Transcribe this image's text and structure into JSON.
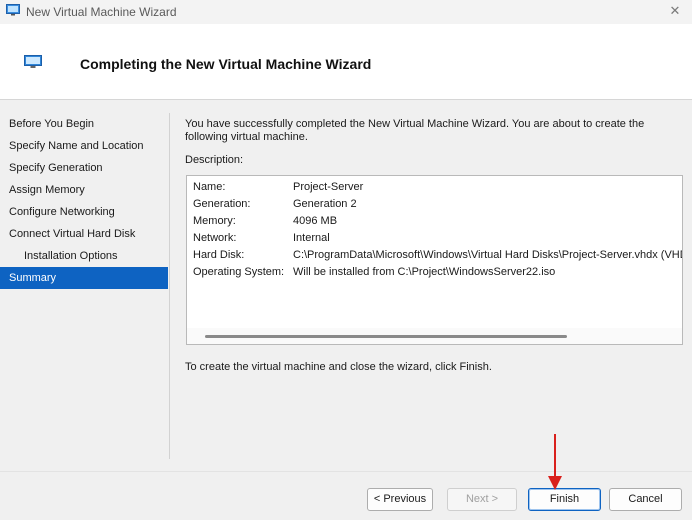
{
  "window": {
    "title": "New Virtual Machine Wizard",
    "close_glyph": "✕"
  },
  "header": {
    "title": "Completing the New Virtual Machine Wizard"
  },
  "nav": {
    "items": [
      {
        "label": "Before You Begin"
      },
      {
        "label": "Specify Name and Location"
      },
      {
        "label": "Specify Generation"
      },
      {
        "label": "Assign Memory"
      },
      {
        "label": "Configure Networking"
      },
      {
        "label": "Connect Virtual Hard Disk"
      },
      {
        "label": "Installation Options"
      },
      {
        "label": "Summary"
      }
    ],
    "active_index": 7
  },
  "main": {
    "intro": "You have successfully completed the New Virtual Machine Wizard. You are about to create the following virtual machine.",
    "description_label": "Description:",
    "rows": [
      {
        "key": "Name:",
        "value": "Project-Server"
      },
      {
        "key": "Generation:",
        "value": "Generation 2"
      },
      {
        "key": "Memory:",
        "value": "4096 MB"
      },
      {
        "key": "Network:",
        "value": "Internal"
      },
      {
        "key": "Hard Disk:",
        "value": "C:\\ProgramData\\Microsoft\\Windows\\Virtual Hard Disks\\Project-Server.vhdx (VHDX, dynamically expanding)"
      },
      {
        "key": "Operating System:",
        "value": "Will be installed from C:\\Project\\WindowsServer22.iso"
      }
    ],
    "finish_note": "To create the virtual machine and close the wizard, click Finish."
  },
  "footer": {
    "previous_label": "< Previous",
    "next_label": "Next >",
    "finish_label": "Finish",
    "cancel_label": "Cancel"
  },
  "colors": {
    "accent": "#0e63c2",
    "annotation_arrow": "#d9201c"
  }
}
